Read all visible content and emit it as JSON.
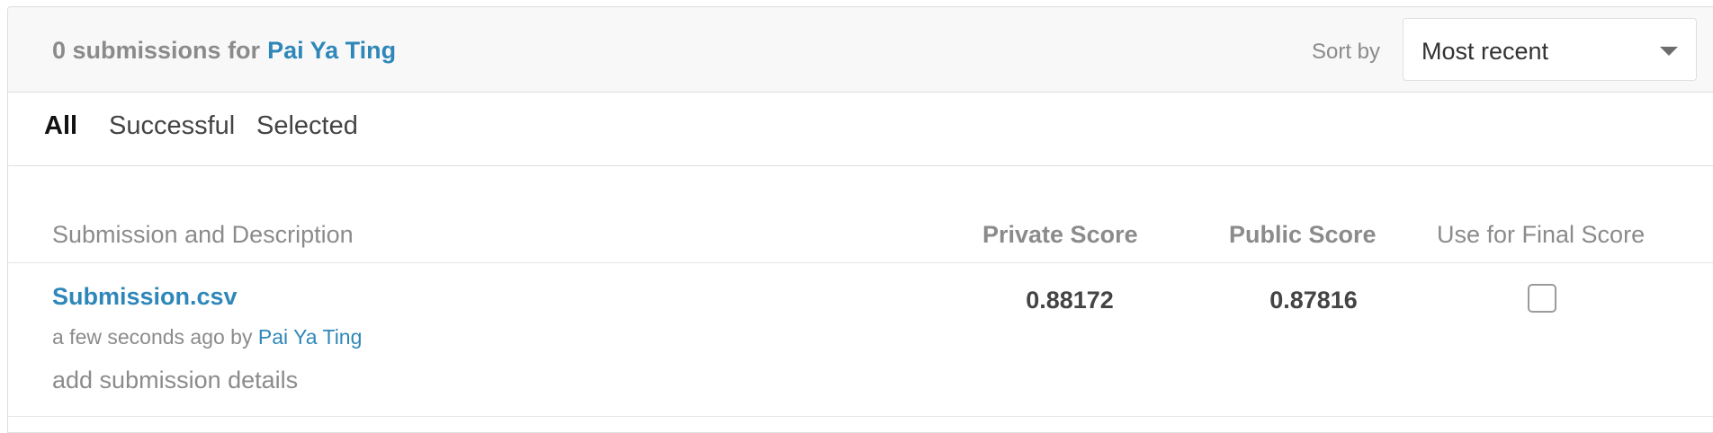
{
  "header": {
    "count_label": "0 submissions for",
    "owner": "Pai Ya Ting",
    "sort_label": "Sort by",
    "sort_value": "Most recent"
  },
  "tabs": [
    {
      "label": "All",
      "active": true
    },
    {
      "label": "Successful",
      "active": false
    },
    {
      "label": "Selected",
      "active": false
    }
  ],
  "columns": {
    "description": "Submission and Description",
    "private": "Private Score",
    "public": "Public Score",
    "final": "Use for Final Score"
  },
  "submissions": [
    {
      "file": "Submission.csv",
      "time": "a few seconds ago by",
      "user": "Pai Ya Ting",
      "details_link": "add submission details",
      "private_score": "0.88172",
      "public_score": "0.87816",
      "use_for_final": false
    }
  ],
  "colors": {
    "link": "#2f87b9",
    "muted": "#8b8b8b",
    "border": "#dedfe0"
  }
}
